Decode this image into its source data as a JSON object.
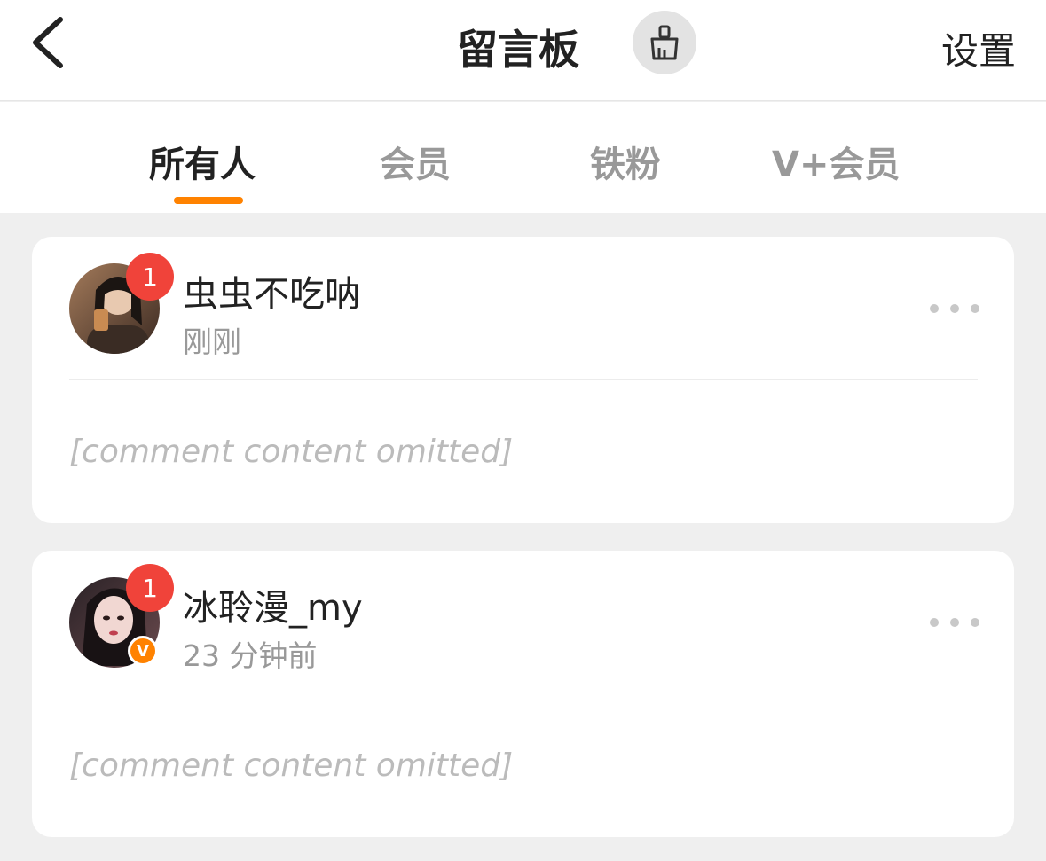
{
  "header": {
    "title": "留言板",
    "settings_label": "设置",
    "back_icon": "chevron-left-icon",
    "broom_icon": "broom-icon"
  },
  "tabs": [
    {
      "label": "所有人",
      "active": true
    },
    {
      "label": "会员",
      "active": false
    },
    {
      "label": "铁粉",
      "active": false
    },
    {
      "label": "V+会员",
      "active": false
    }
  ],
  "colors": {
    "accent": "#ff8200",
    "badge": "#f0433a",
    "page_bg": "#efefef"
  },
  "comments": [
    {
      "author": "虫虫不吃呐",
      "time": "刚刚",
      "badge_count": "1",
      "verified": false,
      "body": "[comment content omitted]"
    },
    {
      "author": "冰聆漫_my",
      "time": "23 分钟前",
      "badge_count": "1",
      "verified": true,
      "verified_label": "V",
      "body": "[comment content omitted]"
    }
  ]
}
